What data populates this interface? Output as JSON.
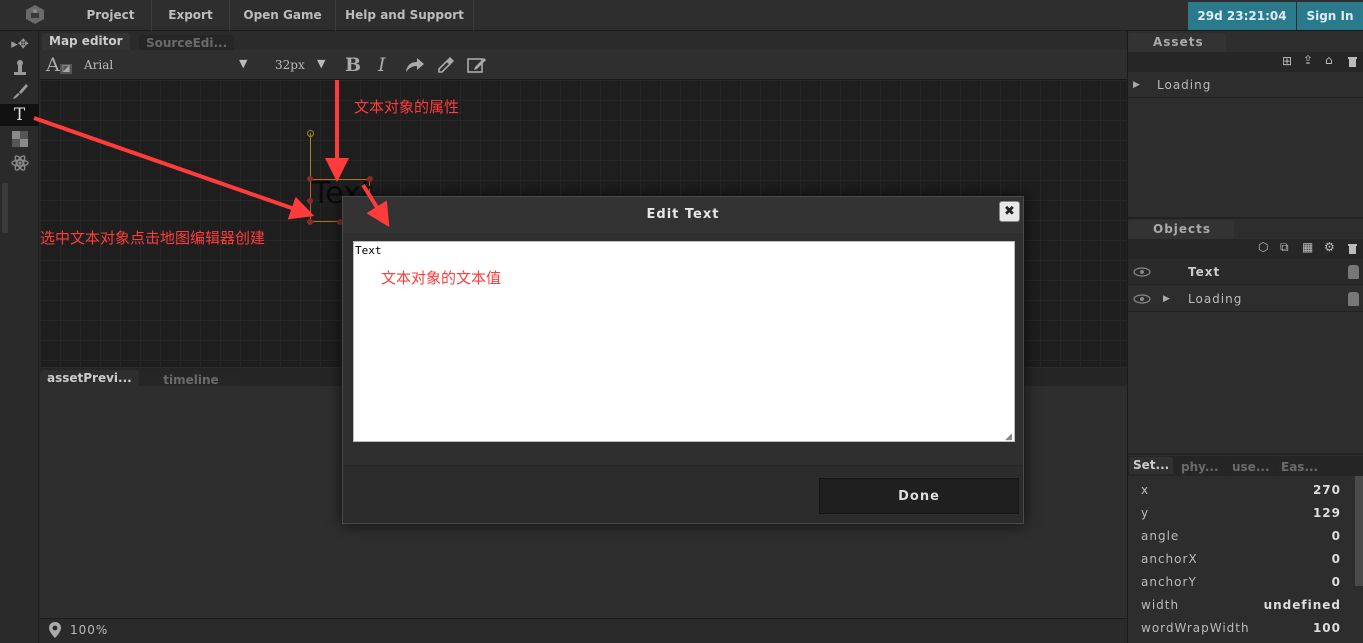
{
  "menu": {
    "items": [
      "Project",
      "Export",
      "Open Game",
      "Help and Support"
    ],
    "clock": "29d 23:21:04",
    "sign_in": "Sign In"
  },
  "editor": {
    "tabs": [
      "Map editor",
      "SourceEdi..."
    ],
    "font_name": "Arial",
    "font_size": "32px",
    "canvas_text": "Text",
    "bottom_tabs": [
      "assetPrevi...",
      "timeline"
    ],
    "zoom": "100%"
  },
  "assets": {
    "title": "Assets",
    "items": [
      "Loading"
    ]
  },
  "objects": {
    "title": "Objects",
    "items": [
      "Text",
      "Loading"
    ]
  },
  "settings": {
    "tabs": [
      "Set...",
      "phy...",
      "use...",
      "Eas..."
    ],
    "props": [
      {
        "key": "x",
        "value": "270"
      },
      {
        "key": "y",
        "value": "129"
      },
      {
        "key": "angle",
        "value": "0"
      },
      {
        "key": "anchorX",
        "value": "0"
      },
      {
        "key": "anchorY",
        "value": "0"
      },
      {
        "key": "width",
        "value": "undefined"
      },
      {
        "key": "wordWrapWidth",
        "value": "100"
      }
    ]
  },
  "modal": {
    "title": "Edit Text",
    "text_value": "Text",
    "done_label": "Done",
    "close_glyph": "✖"
  },
  "annotations": {
    "properties": "文本对象的属性",
    "create_hint": "选中文本对象点击地图编辑器创建",
    "text_value": "文本对象的文本值",
    "color": "#ff3b3b"
  }
}
